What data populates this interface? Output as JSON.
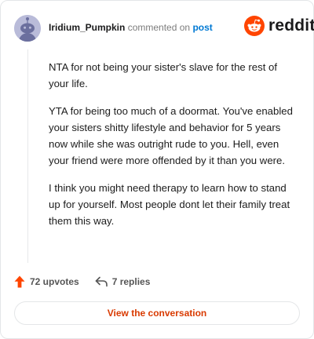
{
  "header": {
    "username": "Iridium_Pumpkin",
    "action_text": "commented on",
    "post_link": "post",
    "brand_name": "reddit"
  },
  "comment": {
    "paragraphs": [
      "NTA for not being your sister's slave for the rest of your life.",
      "YTA for being too much of a doormat. You've enabled your sisters shitty lifestyle and behavior for 5 years now while she was outright rude to you. Hell, even your friend were more offended by it than you were.",
      "I think you might need therapy to learn how to stand up for yourself. Most people dont let their family treat them this way."
    ]
  },
  "stats": {
    "upvotes": "72 upvotes",
    "replies": "7 replies"
  },
  "cta": {
    "label": "View the conversation"
  },
  "colors": {
    "brand_orange": "#ff4500",
    "link_blue": "#0079d3",
    "cta_text": "#d93a00",
    "avatar_bg": "#b9bbd9"
  },
  "icons": {
    "avatar": "snoo-avatar-icon",
    "brand": "reddit-logo-icon",
    "upvote": "upvote-arrow-icon",
    "reply": "reply-arrow-icon"
  }
}
